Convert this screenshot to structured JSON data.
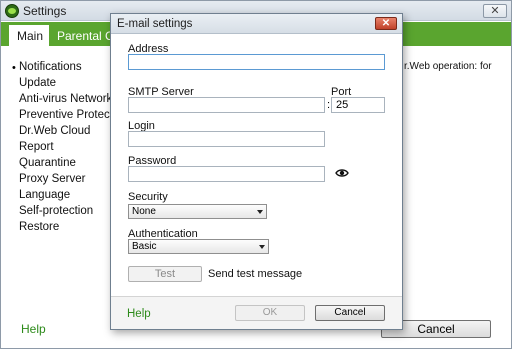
{
  "main_window": {
    "title": "Settings",
    "tabs": [
      {
        "label": "Main",
        "active": true
      },
      {
        "label": "Parental Cont",
        "active": false
      }
    ],
    "sidebar": {
      "bullet": "•",
      "items": [
        {
          "label": "Notifications",
          "selected": true
        },
        {
          "label": "Update"
        },
        {
          "label": "Anti-virus Network"
        },
        {
          "label": "Preventive Protection"
        },
        {
          "label": "Dr.Web Cloud"
        },
        {
          "label": "Report"
        },
        {
          "label": "Quarantine"
        },
        {
          "label": "Proxy Server"
        },
        {
          "label": "Language"
        },
        {
          "label": "Self-protection"
        },
        {
          "label": "Restore"
        }
      ]
    },
    "background_text": "r.Web operation: for",
    "help_label": "Help",
    "cancel_label": "Cancel",
    "close_glyph": "✕"
  },
  "dialog": {
    "title": "E-mail settings",
    "close_glyph": "✕",
    "address": {
      "label": "Address",
      "value": ""
    },
    "smtp": {
      "label": "SMTP Server",
      "value": ""
    },
    "port": {
      "label": "Port",
      "value": "25",
      "separator": ":"
    },
    "login": {
      "label": "Login",
      "value": ""
    },
    "password": {
      "label": "Password",
      "value": ""
    },
    "security": {
      "label": "Security",
      "selected": "None"
    },
    "authentication": {
      "label": "Authentication",
      "selected": "Basic"
    },
    "test_button": "Test",
    "test_caption": "Send test message",
    "help_label": "Help",
    "ok_label": "OK",
    "cancel_label": "Cancel"
  },
  "colors": {
    "accent_green": "#5aa52f",
    "help_green": "#2d8a1a",
    "close_red": "#c0412a"
  },
  "icons": {
    "app": "drweb-spider-icon",
    "show_password": "eye-icon"
  }
}
